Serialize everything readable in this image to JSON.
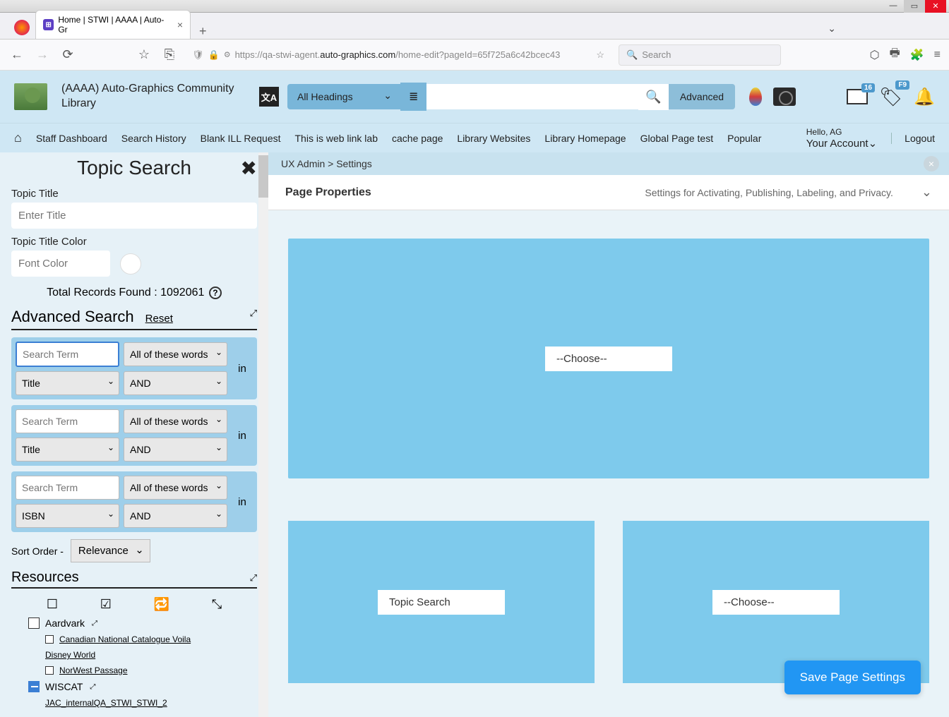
{
  "window": {
    "title": "Home | STWI | AAAA | Auto-Gr"
  },
  "browser": {
    "url_prefix": "https://qa-stwi-agent.",
    "url_domain": "auto-graphics.com",
    "url_path": "/home-edit?pageId=65f725a6c42bcec43",
    "search_placeholder": "Search"
  },
  "header": {
    "org_name": "(AAAA) Auto-Graphics Community Library",
    "headings_dropdown": "All Headings",
    "advanced_button": "Advanced",
    "card_badge": "16",
    "heart_badge": "F9"
  },
  "nav": {
    "links": [
      "Staff Dashboard",
      "Search History",
      "Blank ILL Request",
      "This is web link lab",
      "cache page",
      "Library Websites",
      "Library Homepage",
      "Global Page test",
      "Popular"
    ],
    "hello": "Hello, AG",
    "account": "Your Account",
    "logout": "Logout"
  },
  "left": {
    "panel_title": "Topic Search",
    "topic_title_label": "Topic Title",
    "topic_title_placeholder": "Enter Title",
    "topic_color_label": "Topic Title Color",
    "font_color_placeholder": "Font Color",
    "records_prefix": "Total Records Found : ",
    "records_count": "1092061",
    "adv_search_title": "Advanced Search",
    "reset": "Reset",
    "rows": [
      {
        "term_placeholder": "Search Term",
        "match": "All of these words",
        "field": "Title",
        "op": "AND"
      },
      {
        "term_placeholder": "Search Term",
        "match": "All of these words",
        "field": "Title",
        "op": "AND"
      },
      {
        "term_placeholder": "Search Term",
        "match": "All of these words",
        "field": "ISBN",
        "op": "AND"
      }
    ],
    "in_label": "in",
    "sort_label": "Sort Order -",
    "sort_value": "Relevance",
    "resources_title": "Resources",
    "resource_items": [
      {
        "label": "Aardvark",
        "sub": false,
        "checked": "none"
      },
      {
        "label": "Canadian National Catalogue Voila",
        "sub": true
      },
      {
        "label": "Disney World",
        "sub": true
      },
      {
        "label": "NorWest Passage",
        "sub": true
      },
      {
        "label": "WISCAT",
        "sub": false,
        "checked": "partial"
      },
      {
        "label": "JAC_internalQA_STWI_STWI_2",
        "sub": true
      }
    ]
  },
  "right": {
    "breadcrumb1": "UX Admin",
    "breadcrumb2": "Settings",
    "page_props_title": "Page Properties",
    "page_props_desc": "Settings for Activating, Publishing, Labeling, and Privacy.",
    "widget_choose": "--Choose--",
    "widget_topic_search": "Topic Search",
    "save_button": "Save Page Settings"
  }
}
